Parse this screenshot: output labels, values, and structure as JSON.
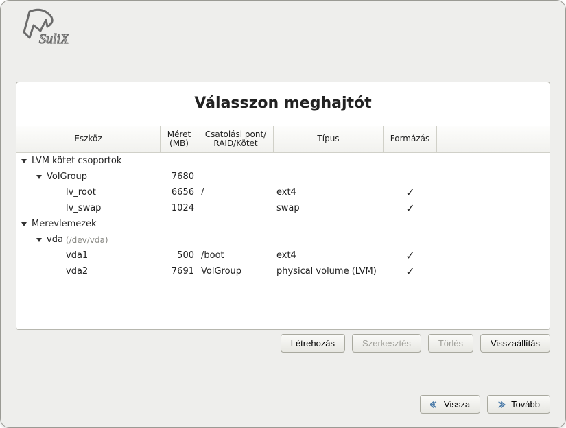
{
  "logo_text": "SuliX",
  "title": "Válasszon meghajtót",
  "columns": {
    "device": "Eszköz",
    "size": "Méret (MB)",
    "mount": "Csatolási pont/ RAID/Kötet",
    "type": "Típus",
    "format": "Formázás"
  },
  "rows": [
    {
      "level": 0,
      "expander": "open",
      "device": "LVM kötet csoportok",
      "size": "",
      "mount": "",
      "type": "",
      "format": false
    },
    {
      "level": 1,
      "expander": "open",
      "device": "VolGroup",
      "size": "7680",
      "mount": "",
      "type": "",
      "format": false
    },
    {
      "level": 2,
      "expander": "none",
      "device": "lv_root",
      "size": "6656",
      "mount": "/",
      "type": "ext4",
      "format": true
    },
    {
      "level": 2,
      "expander": "none",
      "device": "lv_swap",
      "size": "1024",
      "mount": "",
      "type": "swap",
      "format": true
    },
    {
      "level": 0,
      "expander": "open",
      "device": "Merevlemezek",
      "size": "",
      "mount": "",
      "type": "",
      "format": false
    },
    {
      "level": 1,
      "expander": "open",
      "device": "vda",
      "hint": "(/dev/vda)",
      "size": "",
      "mount": "",
      "type": "",
      "format": false
    },
    {
      "level": 2,
      "expander": "none",
      "device": "vda1",
      "size": "500",
      "mount": "/boot",
      "type": "ext4",
      "format": true
    },
    {
      "level": 2,
      "expander": "none",
      "device": "vda2",
      "size": "7691",
      "mount": "VolGroup",
      "type": "physical volume (LVM)",
      "format": true
    }
  ],
  "actions": {
    "create": "Létrehozás",
    "edit": "Szerkesztés",
    "delete": "Törlés",
    "reset": "Visszaállítás"
  },
  "nav": {
    "back": "Vissza",
    "next": "Tovább"
  }
}
